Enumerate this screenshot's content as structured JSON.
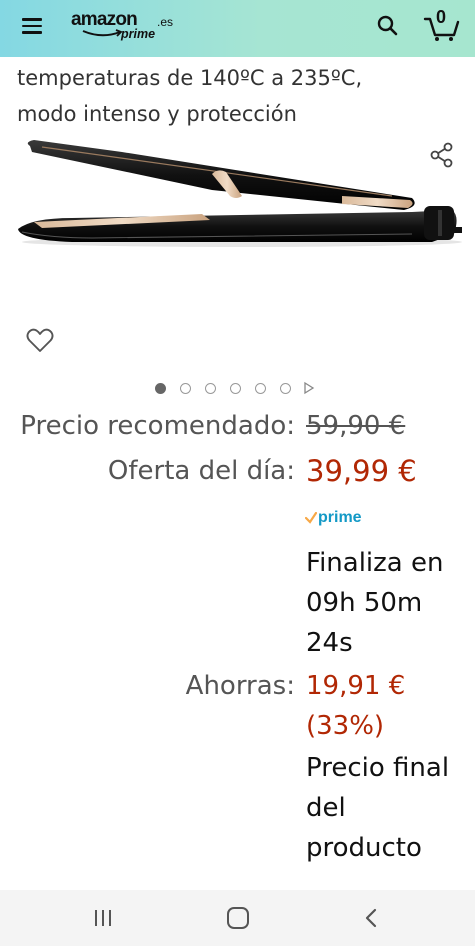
{
  "header": {
    "logo_word": "amazon",
    "logo_tld": ".es",
    "logo_prime": "prime",
    "cart_count": "0"
  },
  "product": {
    "title_line1": "temperaturas de 140ºC a 235ºC,",
    "title_line2": "modo intenso y protección"
  },
  "carousel": {
    "dot_count": 6,
    "active_index": 0
  },
  "pricing": {
    "list_price_label": "Precio recomendado:",
    "list_price": "59,90 €",
    "deal_label": "Oferta del día:",
    "deal_price": "39,99 €",
    "prime_label": "prime",
    "ends_line1": "Finaliza en",
    "ends_line2": "09h 50m",
    "ends_line3": "24s",
    "savings_label": "Ahorras:",
    "savings_line1": "19,91 €",
    "savings_line2": "(33%)",
    "final_line1": "Precio final",
    "final_line2": "del",
    "final_line3": "producto"
  },
  "colors": {
    "header_start": "#84d8e3",
    "header_end": "#a6e6cf",
    "deal_price": "#b12704",
    "prime_blue": "#1399c6",
    "prime_check": "#f7a847"
  },
  "icons": {
    "menu": "menu-icon",
    "search": "search-icon",
    "cart": "cart-icon",
    "share": "share-icon",
    "wishlist": "heart-icon",
    "nav_recent": "recent-apps-icon",
    "nav_home": "home-icon",
    "nav_back": "back-icon"
  }
}
